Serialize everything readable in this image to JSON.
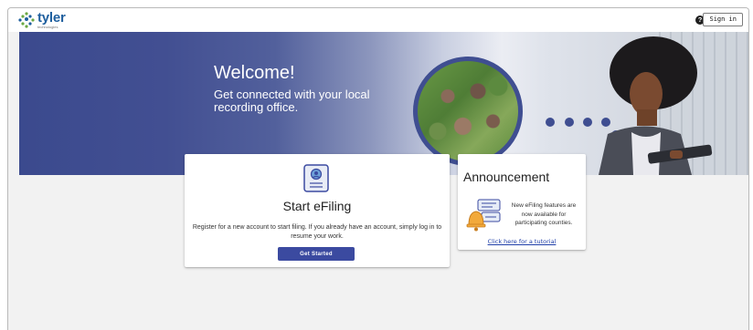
{
  "header": {
    "logo_text": "tyler",
    "logo_subtext": "technologies",
    "help_icon": "question-circle-icon",
    "help_glyph": "?",
    "signin_label": "Sign in"
  },
  "hero": {
    "title": "Welcome!",
    "subtitle": "Get connected with your local recording office."
  },
  "efile_card": {
    "icon": "document-badge-icon",
    "title": "Start eFiling",
    "description": "Register for a new account to start filing. If you already have an account, simply log in to resume your work.",
    "button_label": "Get Started"
  },
  "announcement": {
    "title": "Announcement",
    "icon": "bell-notification-icon",
    "text": "New eFiling features are now available for participating counties.",
    "link_label": "Click here for a tutorial"
  },
  "colors": {
    "brand_blue": "#1f5f9e",
    "hero_navy": "#3f4e91",
    "button": "#3b4aa0",
    "link": "#1f3ea8",
    "page_bg": "#f2f2f2"
  }
}
